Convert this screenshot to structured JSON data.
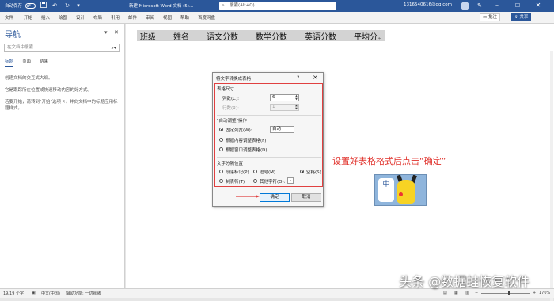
{
  "titlebar": {
    "autosave": "自动保存",
    "autosave_state": "关",
    "doc_title": "新建 Microsoft Word 文档 (5)...",
    "search_placeholder": "搜索(Alt+Q)",
    "account": "1316540616@qq.com",
    "qat_icons": [
      "save-icon",
      "undo-icon",
      "redo-icon",
      "customize-icon"
    ]
  },
  "menu": {
    "items": [
      "文件",
      "开始",
      "插入",
      "绘图",
      "设计",
      "布局",
      "引用",
      "邮件",
      "审阅",
      "视图",
      "帮助",
      "百度网盘"
    ],
    "comment": "批注",
    "share": "共享"
  },
  "nav": {
    "title": "导航",
    "search_placeholder": "在文档中搜索",
    "tabs": [
      "标题",
      "页面",
      "结果"
    ],
    "text1": "创建文档的交互式大纲。",
    "text2": "它是跟踪所在位置或快速移动内容的好方式。",
    "text3": "若要开始，请转到\"开始\"选项卡，并向文档中的标题应用标题样式。"
  },
  "document": {
    "headers": [
      "班级",
      "姓名",
      "语文分数",
      "数学分数",
      "英语分数",
      "平均分"
    ],
    "para_mark": "↵"
  },
  "dialog": {
    "title": "将文字转换成表格",
    "help": "?",
    "close": "×",
    "table_size": "表格尺寸",
    "columns_label": "列数(C):",
    "columns_value": "6",
    "rows_label": "行数(R):",
    "rows_value": "1",
    "autofit_group": "\"自动调整\"操作",
    "fixed_width": "固定列宽(W):",
    "fixed_width_value": "自动",
    "fit_content": "根据内容调整表格(F)",
    "fit_window": "根据窗口调整表格(D)",
    "separator_group": "文字分隔位置",
    "paragraph_mark": "段落标记(P)",
    "comma": "逗号(M)",
    "space": "空格(S)",
    "tab": "制表符(T)",
    "other": "其他字符(O):",
    "other_value": "-",
    "ok": "确定",
    "cancel": "取消"
  },
  "annotation": {
    "text": "设置好表格格式后点击“确定”",
    "sticker_char": "中"
  },
  "statusbar": {
    "words": "19/19 个字",
    "language": "中文(中国)",
    "accessibility": "辅助功能: 一切就绪",
    "zoom": "170%"
  },
  "watermark": "头条 @数据蛙恢复软件",
  "colors": {
    "word_blue": "#2b579a",
    "annotation_red": "#e0302a",
    "highlight_red": "#e04040",
    "header_row_bg": "#d3d3d3"
  }
}
